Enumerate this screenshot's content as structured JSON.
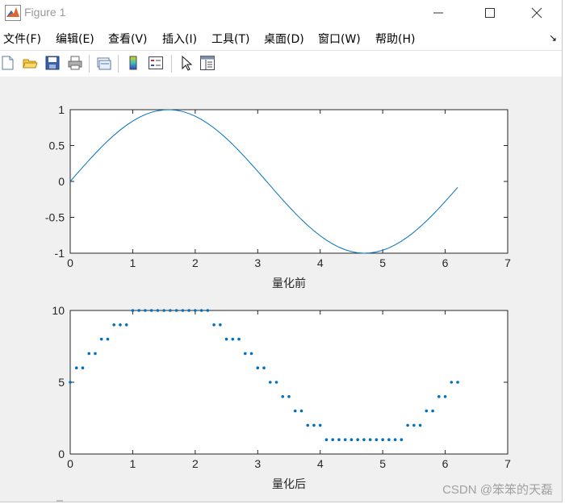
{
  "window": {
    "title": "Figure 1",
    "menu": [
      "文件(F)",
      "编辑(E)",
      "查看(V)",
      "插入(I)",
      "工具(T)",
      "桌面(D)",
      "窗口(W)",
      "帮助(H)"
    ],
    "toolbar_icons": [
      "new-figure-icon",
      "open-file-icon",
      "save-icon",
      "print-icon",
      "link-icon",
      "colorbar-icon",
      "legend-icon",
      "pointer-icon",
      "property-editor-icon"
    ]
  },
  "watermark": "CSDN @笨笨的天磊",
  "chart_data": [
    {
      "type": "line",
      "title": "",
      "xlabel": "量化前",
      "ylabel": "",
      "xlim": [
        0,
        7
      ],
      "ylim": [
        -1,
        1
      ],
      "xticks": [
        0,
        1,
        2,
        3,
        4,
        5,
        6,
        7
      ],
      "yticks": [
        -1,
        -0.5,
        0,
        0.5,
        1
      ],
      "xtick_labels": [
        "0",
        "1",
        "2",
        "3",
        "4",
        "5",
        "6",
        "7"
      ],
      "ytick_labels": [
        "-1",
        "-0.5",
        "0",
        "0.5",
        "1"
      ],
      "grid": false,
      "color": "#0072bd",
      "series": [
        {
          "x": [
            0,
            0.1,
            0.2,
            0.3,
            0.4,
            0.5,
            0.6,
            0.7,
            0.8,
            0.9,
            1.0,
            1.1,
            1.2,
            1.3,
            1.4,
            1.5,
            1.6,
            1.7,
            1.8,
            1.9,
            2.0,
            2.1,
            2.2,
            2.3,
            2.4,
            2.5,
            2.6,
            2.7,
            2.8,
            2.9,
            3.0,
            3.1,
            3.2,
            3.3,
            3.4,
            3.5,
            3.6,
            3.7,
            3.8,
            3.9,
            4.0,
            4.1,
            4.2,
            4.3,
            4.4,
            4.5,
            4.6,
            4.7,
            4.8,
            4.9,
            5.0,
            5.1,
            5.2,
            5.3,
            5.4,
            5.5,
            5.6,
            5.7,
            5.8,
            5.9,
            6.0,
            6.1,
            6.2
          ],
          "y": [
            0,
            0.1,
            0.199,
            0.296,
            0.389,
            0.479,
            0.565,
            0.644,
            0.717,
            0.783,
            0.841,
            0.891,
            0.932,
            0.964,
            0.985,
            0.997,
            1.0,
            0.992,
            0.974,
            0.946,
            0.909,
            0.863,
            0.808,
            0.746,
            0.675,
            0.598,
            0.516,
            0.427,
            0.335,
            0.239,
            0.141,
            0.042,
            -0.058,
            -0.158,
            -0.256,
            -0.351,
            -0.443,
            -0.53,
            -0.612,
            -0.688,
            -0.757,
            -0.818,
            -0.872,
            -0.916,
            -0.952,
            -0.978,
            -0.994,
            -1.0,
            -0.996,
            -0.982,
            -0.959,
            -0.926,
            -0.883,
            -0.832,
            -0.773,
            -0.706,
            -0.631,
            -0.551,
            -0.465,
            -0.374,
            -0.279,
            -0.182,
            -0.083
          ]
        }
      ]
    },
    {
      "type": "scatter",
      "title": "",
      "xlabel": "量化后",
      "ylabel": "",
      "xlim": [
        0,
        7
      ],
      "ylim": [
        0,
        10
      ],
      "xticks": [
        0,
        1,
        2,
        3,
        4,
        5,
        6,
        7
      ],
      "yticks": [
        0,
        5,
        10
      ],
      "xtick_labels": [
        "0",
        "1",
        "2",
        "3",
        "4",
        "5",
        "6",
        "7"
      ],
      "ytick_labels": [
        "0",
        "5",
        "10"
      ],
      "grid": false,
      "color": "#0072bd",
      "series": [
        {
          "x": [
            0,
            0.1,
            0.2,
            0.3,
            0.4,
            0.5,
            0.6,
            0.7,
            0.8,
            0.9,
            1.0,
            1.1,
            1.2,
            1.3,
            1.4,
            1.5,
            1.6,
            1.7,
            1.8,
            1.9,
            2.0,
            2.1,
            2.2,
            2.3,
            2.4,
            2.5,
            2.6,
            2.7,
            2.8,
            2.9,
            3.0,
            3.1,
            3.2,
            3.3,
            3.4,
            3.5,
            3.6,
            3.7,
            3.8,
            3.9,
            4.0,
            4.1,
            4.2,
            4.3,
            4.4,
            4.5,
            4.6,
            4.7,
            4.8,
            4.9,
            5.0,
            5.1,
            5.2,
            5.3,
            5.4,
            5.5,
            5.6,
            5.7,
            5.8,
            5.9,
            6.0,
            6.1,
            6.2
          ],
          "y": [
            5,
            6,
            6,
            7,
            7,
            8,
            8,
            9,
            9,
            9,
            10,
            10,
            10,
            10,
            10,
            10,
            10,
            10,
            10,
            10,
            10,
            10,
            10,
            9,
            9,
            8,
            8,
            8,
            7,
            7,
            6,
            6,
            5,
            5,
            4,
            4,
            3,
            3,
            2,
            2,
            2,
            1,
            1,
            1,
            1,
            1,
            1,
            1,
            1,
            1,
            1,
            1,
            1,
            1,
            2,
            2,
            2,
            3,
            3,
            4,
            4,
            5,
            5
          ]
        }
      ]
    }
  ]
}
